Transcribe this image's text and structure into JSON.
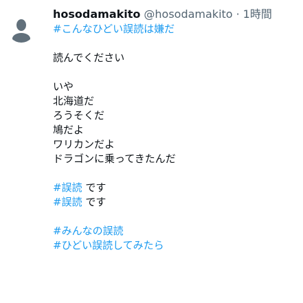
{
  "tweet": {
    "display_name": "hosodamakito",
    "handle": "@hosodamakito",
    "separator": "·",
    "time": "1時間",
    "line_1": "#こんなひどい誤読は嫌だ",
    "line_2": "読んでください",
    "line_3": "いや",
    "line_4": "北海道だ",
    "line_5": "ろうそくだ",
    "line_6": "鳩だよ",
    "line_7": "ワリカンだよ",
    "line_8": "ドラゴンに乗ってきたんだ",
    "line_9_tag": "#誤読",
    "line_9_text": "です",
    "line_10_tag": "#誤読",
    "line_10_text": "です",
    "line_11": "#みんなの誤読",
    "line_12": "#ひどい誤読してみたら"
  },
  "colors": {
    "link": "#1d9bf0",
    "text": "#0f1419",
    "secondary": "#536471"
  },
  "icons": {
    "avatar": "default-user-avatar-icon"
  }
}
